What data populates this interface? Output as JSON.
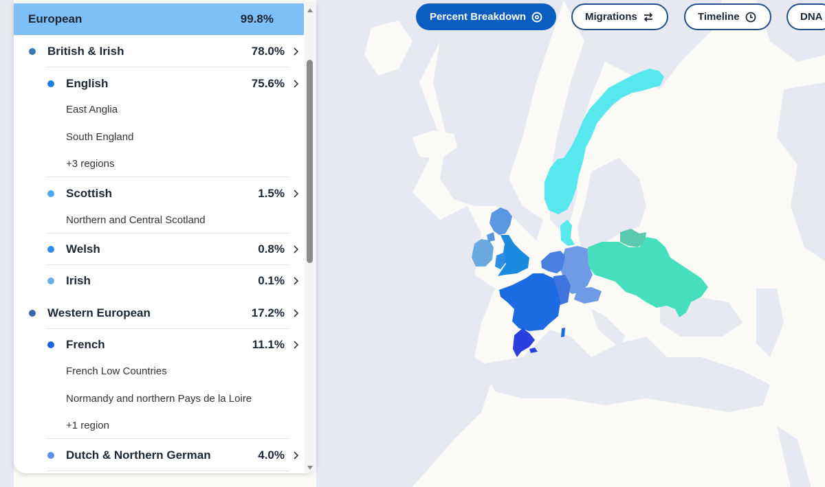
{
  "toolbar": {
    "percent_breakdown": "Percent Breakdown",
    "migrations": "Migrations",
    "timeline": "Timeline",
    "dna": "DNA"
  },
  "panel": {
    "header": {
      "label": "European",
      "percent": "99.8%"
    },
    "groups": [
      {
        "label": "British & Irish",
        "percent": "78.0%",
        "color": "#3e78b3"
      },
      {
        "label": "English",
        "percent": "75.6%",
        "color": "#1b7fe0",
        "regions": [
          "East Anglia",
          "South England",
          "+3 regions"
        ]
      },
      {
        "label": "Scottish",
        "percent": "1.5%",
        "color": "#4da6f0",
        "regions": [
          "Northern and Central Scotland"
        ]
      },
      {
        "label": "Welsh",
        "percent": "0.8%",
        "color": "#2e8ee6"
      },
      {
        "label": "Irish",
        "percent": "0.1%",
        "color": "#6aaee8"
      },
      {
        "label": "Western European",
        "percent": "17.2%",
        "color": "#3d62a8"
      },
      {
        "label": "French",
        "percent": "11.1%",
        "color": "#1b63db",
        "regions": [
          "French Low Countries",
          "Normandy and northern Pays de la Loire",
          "+1 region"
        ]
      },
      {
        "label": "Dutch & Northern German",
        "percent": "4.0%",
        "color": "#5b8fe6"
      }
    ]
  },
  "map_colors": {
    "background": "#fbfaf7",
    "water": "#e6e8f2",
    "norway": "#56e8ec",
    "east": "#45dfbe",
    "lithuania": "#5bc9ad",
    "france": "#1d6be0",
    "spain_east": "#2a3fdc",
    "england": "#1b8be0",
    "ireland": "#69a9e0",
    "scotland": "#5b97e0",
    "germany": "#6f9be6",
    "benelux": "#4b7fe0"
  }
}
